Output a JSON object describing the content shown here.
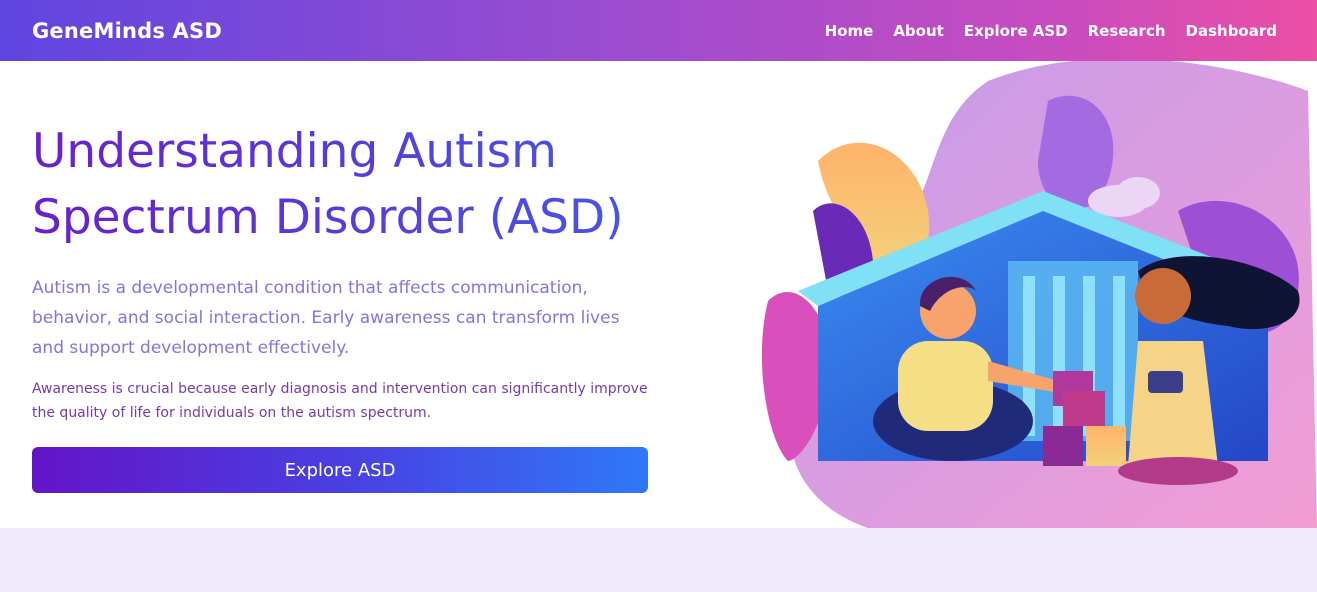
{
  "nav": {
    "brand": "GeneMinds ASD",
    "links": [
      {
        "label": "Home"
      },
      {
        "label": "About"
      },
      {
        "label": "Explore ASD"
      },
      {
        "label": "Research"
      },
      {
        "label": "Dashboard"
      }
    ]
  },
  "hero": {
    "title_line1": "Understanding Autism",
    "title_line2": "Spectrum Disorder (ASD)",
    "lead": "Autism is a developmental condition that affects communication, behavior, and social interaction. Early awareness can transform lives and support development effectively.",
    "note": "Awareness is crucial because early diagnosis and intervention can significantly improve the quality of life for individuals on the autism spectrum.",
    "cta_label": "Explore ASD"
  },
  "illustration": {
    "icon": "children-playing-illustration"
  },
  "colors": {
    "nav_start": "#5f45e0",
    "nav_end": "#ec4fa3",
    "cta_start": "#6414c8",
    "cta_end": "#2f78f8",
    "lower_section_bg": "#f1eafb"
  }
}
